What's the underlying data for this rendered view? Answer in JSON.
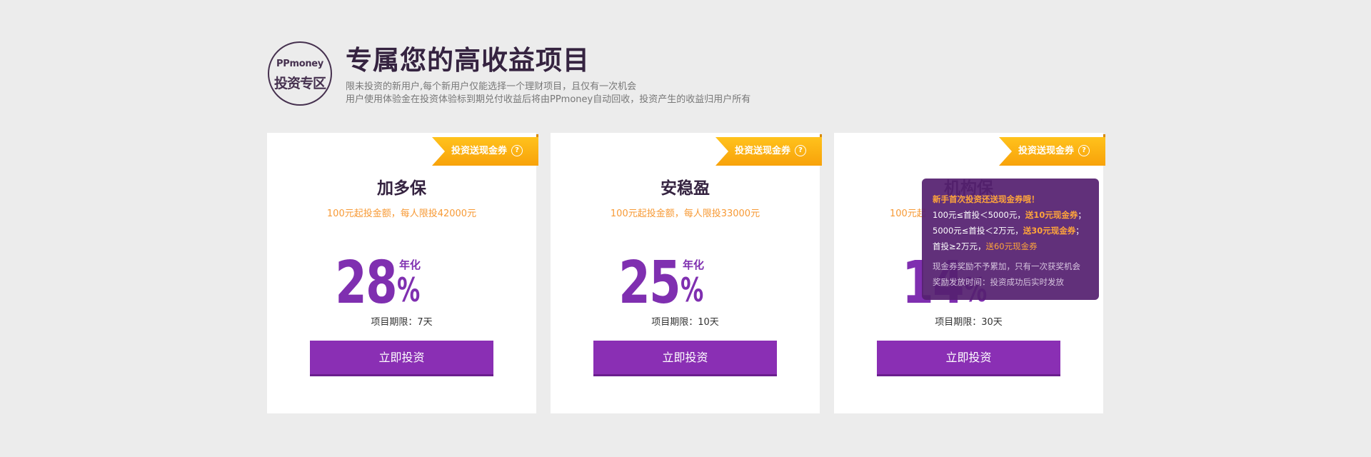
{
  "header": {
    "logo_top": "PPmoney",
    "logo_bottom": "投资专区",
    "title": "专属您的高收益项目",
    "subtitle1": "限未投资的新用户,每个新用户仅能选择一个理财项目，且仅有一次机会",
    "subtitle2": "用户使用体验金在投资体验标到期兑付收益后将由PPmoney自动回收，投资产生的收益归用户所有"
  },
  "colors": {
    "accent": "#8a2fb4",
    "orange": "#f79a36",
    "ribbon": "#f8a20a",
    "background": "#ececec"
  },
  "cards": [
    {
      "ribbon": "投资送现金券",
      "name": "加多保",
      "desc": "100元起投金额，每人限投42000元",
      "rate": "28",
      "rate_label": "年化",
      "pct": "%",
      "term": "项目期限：7天",
      "button": "立即投资"
    },
    {
      "ribbon": "投资送现金券",
      "name": "安稳盈",
      "desc": "100元起投金额，每人限投33000元",
      "rate": "25",
      "rate_label": "年化",
      "pct": "%",
      "term": "项目期限：10天",
      "button": "立即投资"
    },
    {
      "ribbon": "投资送现金券",
      "name": "机构保",
      "desc": "100元起",
      "rate": "14",
      "rate_label": "",
      "pct": "%",
      "term": "项目期限：30天",
      "button": "立即投资"
    }
  ],
  "tooltip": {
    "heading": "新手首次投资还送现金券哦！",
    "l1a": "100元≤首投＜5000元，",
    "l1b": "送10元现金券",
    "l1c": "；",
    "l2a": "5000元≤首投＜2万元，",
    "l2b": "送30元现金券",
    "l2c": "；",
    "l3a": "首投≥2万元，",
    "l3b": "送60元现金券",
    "note1": "现金券奖励不予累加，只有一次获奖机会",
    "note2": "奖励发放时间：投资成功后实时发放"
  }
}
